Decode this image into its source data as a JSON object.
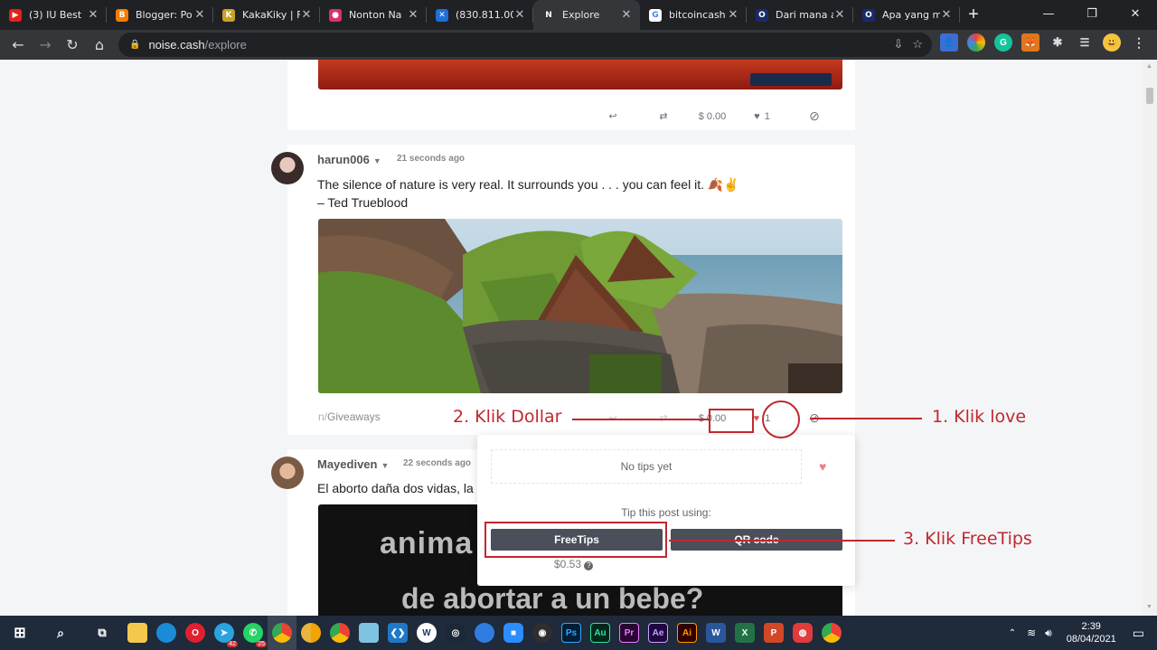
{
  "tabs": [
    {
      "title": "(3) IU Best",
      "color": "#e62117",
      "glyph": "▶"
    },
    {
      "title": "Blogger: Po",
      "color": "#f57d00",
      "glyph": "B"
    },
    {
      "title": "KakaKiky | F",
      "color": "#c9a227",
      "glyph": "K"
    },
    {
      "title": "Nonton Na",
      "color": "#d6336c",
      "glyph": "●"
    },
    {
      "title": "(830.811.00",
      "color": "#1e6fd9",
      "glyph": "✕"
    },
    {
      "title": "Explore",
      "color": "#35363a",
      "glyph": "N",
      "active": true
    },
    {
      "title": "bitcoincash",
      "color": "#ffffff",
      "glyph": "G"
    },
    {
      "title": "Dari mana a",
      "color": "#1a2b6b",
      "glyph": "O"
    },
    {
      "title": "Apa yang m",
      "color": "#1a2b6b",
      "glyph": "O"
    }
  ],
  "address": {
    "host": "noise.cash",
    "path": "/explore"
  },
  "post1_actions": {
    "tip": "$ 0.00",
    "likes": "1"
  },
  "post2": {
    "user": "harun006",
    "time": "21 seconds ago",
    "text_line1": "The silence of nature is very real. It surrounds you . . . you can feel it. 🍂✌",
    "text_line2": "– Ted Trueblood",
    "channel_prefix": "n/",
    "channel": "Giveaways",
    "tip": "$ 0.00",
    "likes": "1"
  },
  "post3": {
    "user": "Mayediven",
    "time": "22 seconds ago",
    "text": "El aborto daña dos vidas, la",
    "image_line1": "anima",
    "image_line2": "de abortar a un bebe?"
  },
  "popup": {
    "no_tips": "No tips yet",
    "tip_header": "Tip this post using:",
    "freetips": "FreeTips",
    "qrcode": "QR code",
    "balance": "$0.53"
  },
  "annotations": {
    "step1": "1. Klik love",
    "step2": "2. Klik Dollar",
    "step3": "3. Klik FreeTips"
  },
  "taskbar": {
    "time": "2:39",
    "date": "08/04/2021",
    "badge_telegram": "42",
    "badge_whatsapp": "25"
  }
}
